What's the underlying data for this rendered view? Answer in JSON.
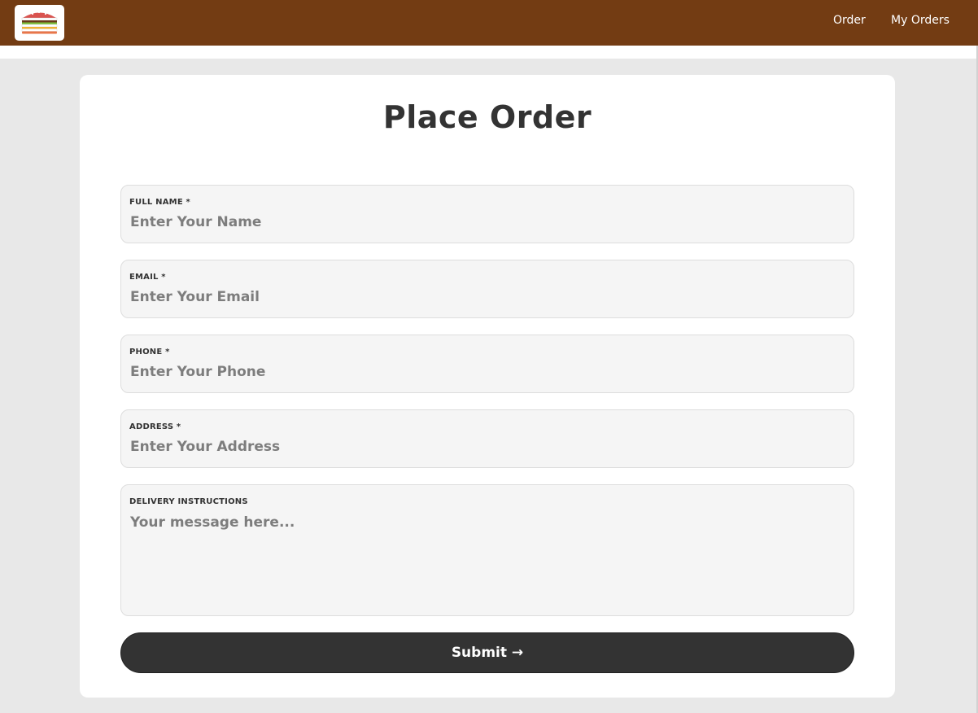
{
  "header": {
    "logo_icon": "burger-icon",
    "background_color": "#733c13",
    "nav": [
      {
        "label": "Order"
      },
      {
        "label": "My Orders"
      }
    ]
  },
  "form": {
    "title": "Place Order",
    "fields": [
      {
        "label": "FULL NAME *",
        "placeholder": "Enter Your Name",
        "value": ""
      },
      {
        "label": "EMAIL *",
        "placeholder": "Enter Your Email",
        "value": ""
      },
      {
        "label": "PHONE *",
        "placeholder": "Enter Your Phone",
        "value": ""
      },
      {
        "label": "ADDRESS *",
        "placeholder": "Enter Your Address",
        "value": ""
      },
      {
        "label": "DELIVERY INSTRUCTIONS",
        "placeholder": "Your message here...",
        "value": ""
      }
    ],
    "submit_label": "Submit →",
    "submit_color": "#333333"
  }
}
